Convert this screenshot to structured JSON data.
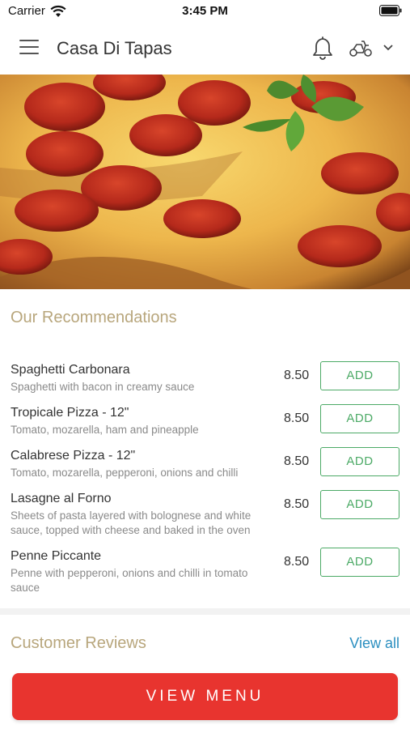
{
  "status_bar": {
    "carrier": "Carrier",
    "time": "3:45 PM"
  },
  "header": {
    "title": "Casa Di Tapas",
    "icons": [
      "menu-icon",
      "bell-icon",
      "scooter-icon",
      "chevron-down-icon"
    ]
  },
  "hero": {
    "image": "pepperoni-pizza-photo"
  },
  "recommendations": {
    "title": "Our Recommendations",
    "items": [
      {
        "name": "Spaghetti Carbonara",
        "description": "Spaghetti with bacon in creamy sauce",
        "price": "8.50",
        "button": "ADD"
      },
      {
        "name": "Tropicale Pizza - 12\"",
        "description": "Tomato, mozarella, ham and pineapple",
        "price": "8.50",
        "button": "ADD"
      },
      {
        "name": "Calabrese Pizza - 12\"",
        "description": "Tomato, mozarella, pepperoni, onions and chilli",
        "price": "8.50",
        "button": "ADD"
      },
      {
        "name": "Lasagne al Forno",
        "description": "Sheets of pasta layered with bolognese and white sauce, topped with cheese and baked in the oven",
        "price": "8.50",
        "button": "ADD"
      },
      {
        "name": "Penne Piccante",
        "description": "Penne with pepperoni, onions and chilli in tomato sauce",
        "price": "8.50",
        "button": "ADD"
      }
    ]
  },
  "reviews": {
    "title": "Customer Reviews",
    "view_all": "View all"
  },
  "cta": {
    "label": "VIEW MENU"
  },
  "colors": {
    "accent_red": "#e8342f",
    "add_green": "#4caa66",
    "section_title": "#b8a67c",
    "link_blue": "#2b8fc0"
  }
}
